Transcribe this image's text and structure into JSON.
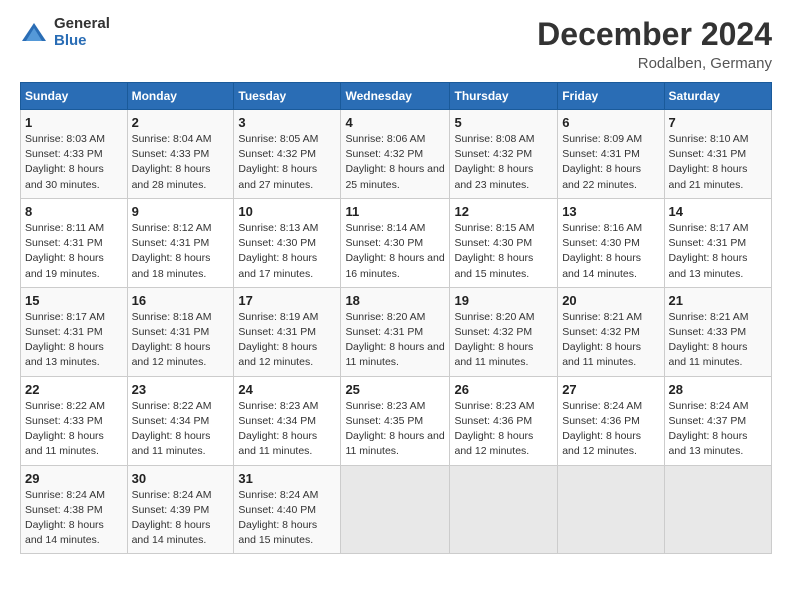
{
  "header": {
    "logo_general": "General",
    "logo_blue": "Blue",
    "month_title": "December 2024",
    "location": "Rodalben, Germany"
  },
  "weekdays": [
    "Sunday",
    "Monday",
    "Tuesday",
    "Wednesday",
    "Thursday",
    "Friday",
    "Saturday"
  ],
  "weeks": [
    [
      {
        "day": "1",
        "sunrise": "Sunrise: 8:03 AM",
        "sunset": "Sunset: 4:33 PM",
        "daylight": "Daylight: 8 hours and 30 minutes."
      },
      {
        "day": "2",
        "sunrise": "Sunrise: 8:04 AM",
        "sunset": "Sunset: 4:33 PM",
        "daylight": "Daylight: 8 hours and 28 minutes."
      },
      {
        "day": "3",
        "sunrise": "Sunrise: 8:05 AM",
        "sunset": "Sunset: 4:32 PM",
        "daylight": "Daylight: 8 hours and 27 minutes."
      },
      {
        "day": "4",
        "sunrise": "Sunrise: 8:06 AM",
        "sunset": "Sunset: 4:32 PM",
        "daylight": "Daylight: 8 hours and 25 minutes."
      },
      {
        "day": "5",
        "sunrise": "Sunrise: 8:08 AM",
        "sunset": "Sunset: 4:32 PM",
        "daylight": "Daylight: 8 hours and 23 minutes."
      },
      {
        "day": "6",
        "sunrise": "Sunrise: 8:09 AM",
        "sunset": "Sunset: 4:31 PM",
        "daylight": "Daylight: 8 hours and 22 minutes."
      },
      {
        "day": "7",
        "sunrise": "Sunrise: 8:10 AM",
        "sunset": "Sunset: 4:31 PM",
        "daylight": "Daylight: 8 hours and 21 minutes."
      }
    ],
    [
      {
        "day": "8",
        "sunrise": "Sunrise: 8:11 AM",
        "sunset": "Sunset: 4:31 PM",
        "daylight": "Daylight: 8 hours and 19 minutes."
      },
      {
        "day": "9",
        "sunrise": "Sunrise: 8:12 AM",
        "sunset": "Sunset: 4:31 PM",
        "daylight": "Daylight: 8 hours and 18 minutes."
      },
      {
        "day": "10",
        "sunrise": "Sunrise: 8:13 AM",
        "sunset": "Sunset: 4:30 PM",
        "daylight": "Daylight: 8 hours and 17 minutes."
      },
      {
        "day": "11",
        "sunrise": "Sunrise: 8:14 AM",
        "sunset": "Sunset: 4:30 PM",
        "daylight": "Daylight: 8 hours and 16 minutes."
      },
      {
        "day": "12",
        "sunrise": "Sunrise: 8:15 AM",
        "sunset": "Sunset: 4:30 PM",
        "daylight": "Daylight: 8 hours and 15 minutes."
      },
      {
        "day": "13",
        "sunrise": "Sunrise: 8:16 AM",
        "sunset": "Sunset: 4:30 PM",
        "daylight": "Daylight: 8 hours and 14 minutes."
      },
      {
        "day": "14",
        "sunrise": "Sunrise: 8:17 AM",
        "sunset": "Sunset: 4:31 PM",
        "daylight": "Daylight: 8 hours and 13 minutes."
      }
    ],
    [
      {
        "day": "15",
        "sunrise": "Sunrise: 8:17 AM",
        "sunset": "Sunset: 4:31 PM",
        "daylight": "Daylight: 8 hours and 13 minutes."
      },
      {
        "day": "16",
        "sunrise": "Sunrise: 8:18 AM",
        "sunset": "Sunset: 4:31 PM",
        "daylight": "Daylight: 8 hours and 12 minutes."
      },
      {
        "day": "17",
        "sunrise": "Sunrise: 8:19 AM",
        "sunset": "Sunset: 4:31 PM",
        "daylight": "Daylight: 8 hours and 12 minutes."
      },
      {
        "day": "18",
        "sunrise": "Sunrise: 8:20 AM",
        "sunset": "Sunset: 4:31 PM",
        "daylight": "Daylight: 8 hours and 11 minutes."
      },
      {
        "day": "19",
        "sunrise": "Sunrise: 8:20 AM",
        "sunset": "Sunset: 4:32 PM",
        "daylight": "Daylight: 8 hours and 11 minutes."
      },
      {
        "day": "20",
        "sunrise": "Sunrise: 8:21 AM",
        "sunset": "Sunset: 4:32 PM",
        "daylight": "Daylight: 8 hours and 11 minutes."
      },
      {
        "day": "21",
        "sunrise": "Sunrise: 8:21 AM",
        "sunset": "Sunset: 4:33 PM",
        "daylight": "Daylight: 8 hours and 11 minutes."
      }
    ],
    [
      {
        "day": "22",
        "sunrise": "Sunrise: 8:22 AM",
        "sunset": "Sunset: 4:33 PM",
        "daylight": "Daylight: 8 hours and 11 minutes."
      },
      {
        "day": "23",
        "sunrise": "Sunrise: 8:22 AM",
        "sunset": "Sunset: 4:34 PM",
        "daylight": "Daylight: 8 hours and 11 minutes."
      },
      {
        "day": "24",
        "sunrise": "Sunrise: 8:23 AM",
        "sunset": "Sunset: 4:34 PM",
        "daylight": "Daylight: 8 hours and 11 minutes."
      },
      {
        "day": "25",
        "sunrise": "Sunrise: 8:23 AM",
        "sunset": "Sunset: 4:35 PM",
        "daylight": "Daylight: 8 hours and 11 minutes."
      },
      {
        "day": "26",
        "sunrise": "Sunrise: 8:23 AM",
        "sunset": "Sunset: 4:36 PM",
        "daylight": "Daylight: 8 hours and 12 minutes."
      },
      {
        "day": "27",
        "sunrise": "Sunrise: 8:24 AM",
        "sunset": "Sunset: 4:36 PM",
        "daylight": "Daylight: 8 hours and 12 minutes."
      },
      {
        "day": "28",
        "sunrise": "Sunrise: 8:24 AM",
        "sunset": "Sunset: 4:37 PM",
        "daylight": "Daylight: 8 hours and 13 minutes."
      }
    ],
    [
      {
        "day": "29",
        "sunrise": "Sunrise: 8:24 AM",
        "sunset": "Sunset: 4:38 PM",
        "daylight": "Daylight: 8 hours and 14 minutes."
      },
      {
        "day": "30",
        "sunrise": "Sunrise: 8:24 AM",
        "sunset": "Sunset: 4:39 PM",
        "daylight": "Daylight: 8 hours and 14 minutes."
      },
      {
        "day": "31",
        "sunrise": "Sunrise: 8:24 AM",
        "sunset": "Sunset: 4:40 PM",
        "daylight": "Daylight: 8 hours and 15 minutes."
      },
      null,
      null,
      null,
      null
    ]
  ]
}
